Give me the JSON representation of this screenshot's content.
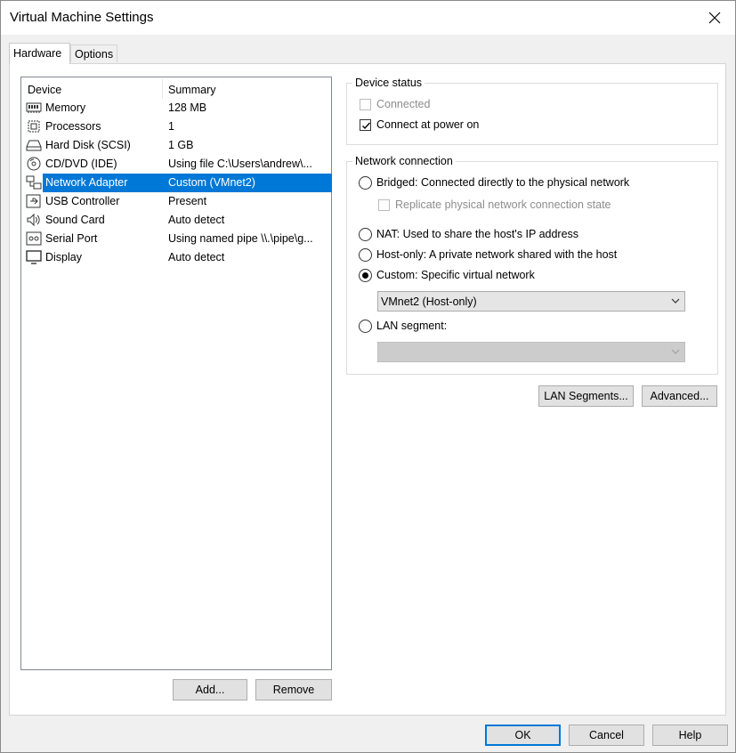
{
  "window": {
    "title": "Virtual Machine Settings"
  },
  "tabs": [
    {
      "label": "Hardware",
      "active": true
    },
    {
      "label": "Options",
      "active": false
    }
  ],
  "device_list": {
    "columns": [
      "Device",
      "Summary"
    ],
    "rows": [
      {
        "icon": "memory-icon",
        "device": "Memory",
        "summary": "128 MB"
      },
      {
        "icon": "processor-icon",
        "device": "Processors",
        "summary": "1"
      },
      {
        "icon": "hard-disk-icon",
        "device": "Hard Disk (SCSI)",
        "summary": "1 GB"
      },
      {
        "icon": "cd-dvd-icon",
        "device": "CD/DVD (IDE)",
        "summary": "Using file C:\\Users\\andrew\\..."
      },
      {
        "icon": "network-adapter-icon",
        "device": "Network Adapter",
        "summary": "Custom (VMnet2)",
        "selected": true
      },
      {
        "icon": "usb-icon",
        "device": "USB Controller",
        "summary": "Present"
      },
      {
        "icon": "sound-icon",
        "device": "Sound Card",
        "summary": "Auto detect"
      },
      {
        "icon": "serial-port-icon",
        "device": "Serial Port",
        "summary": "Using named pipe \\\\.\\pipe\\g..."
      },
      {
        "icon": "display-icon",
        "device": "Display",
        "summary": "Auto detect"
      }
    ]
  },
  "list_buttons": {
    "add": "Add...",
    "remove": "Remove"
  },
  "device_status": {
    "title": "Device status",
    "connected": {
      "label": "Connected",
      "checked": false,
      "disabled": true
    },
    "connect_at_power_on": {
      "label": "Connect at power on",
      "checked": true
    }
  },
  "network_connection": {
    "title": "Network connection",
    "bridged": "Bridged: Connected directly to the physical network",
    "replicate": "Replicate physical network connection state",
    "nat": "NAT: Used to share the host's IP address",
    "host_only": "Host-only: A private network shared with the host",
    "custom": "Custom: Specific virtual network",
    "selected": "custom",
    "custom_network": "VMnet2 (Host-only)",
    "lan_segment": "LAN segment:",
    "lan_segment_value": ""
  },
  "side_buttons": {
    "lan_segments": "LAN Segments...",
    "advanced": "Advanced..."
  },
  "footer_buttons": {
    "ok": "OK",
    "cancel": "Cancel",
    "help": "Help"
  },
  "colors": {
    "accent": "#0078d7",
    "selection": "#0078d7",
    "window_bg": "#f0f0f0"
  }
}
